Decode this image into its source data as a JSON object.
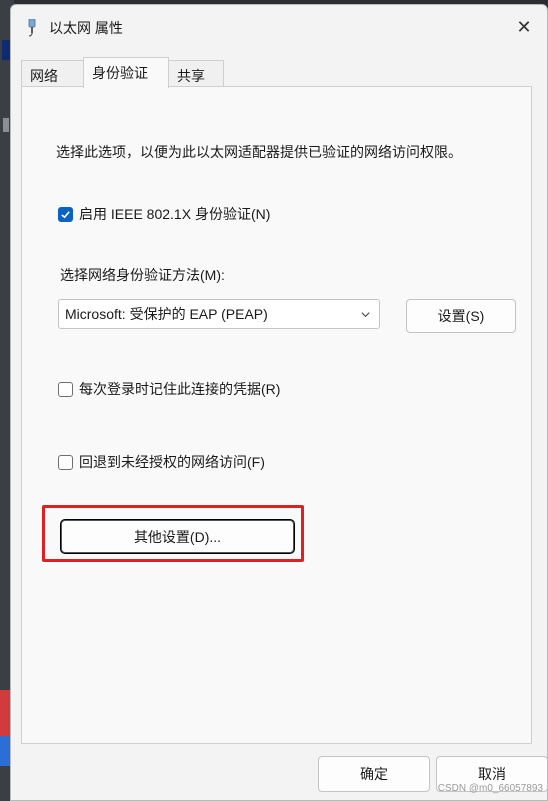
{
  "window": {
    "title": "以太网 属性",
    "close_glyph": "✕"
  },
  "tabs": [
    {
      "label": "网络"
    },
    {
      "label": "身份验证"
    },
    {
      "label": "共享"
    }
  ],
  "panel": {
    "description": "选择此选项，以便为此以太网适配器提供已验证的网络访问权限。",
    "enable_8021x": {
      "label": "启用 IEEE 802.1X 身份验证(N)",
      "checked": true
    },
    "method_label": "选择网络身份验证方法(M):",
    "method_select": {
      "value": "Microsoft: 受保护的 EAP (PEAP)"
    },
    "settings_button": "设置(S)",
    "remember_credentials": {
      "label": "每次登录时记住此连接的凭据(R)",
      "checked": false
    },
    "fallback_unauthorized": {
      "label": "回退到未经授权的网络访问(F)",
      "checked": false
    },
    "advanced_button": "其他设置(D)..."
  },
  "footer": {
    "ok_label": "确定",
    "cancel_label": "取消"
  },
  "watermark": "CSDN @m0_66057893",
  "colors": {
    "accent": "#0a62c4",
    "highlight": "#e02020"
  },
  "icons": {
    "title": "network-adapter-icon",
    "close": "close-icon",
    "check": "checkmark-icon",
    "dropdown": "chevron-down-icon"
  }
}
